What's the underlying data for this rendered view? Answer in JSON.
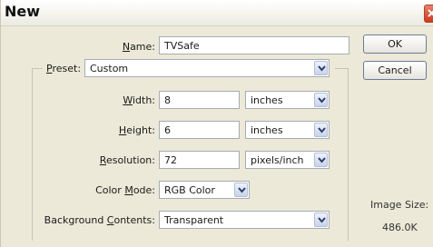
{
  "dialog": {
    "title": "New",
    "buttons": {
      "ok": "OK",
      "cancel": "Cancel"
    }
  },
  "form": {
    "name": {
      "label": "Name:",
      "value": "TVSafe"
    },
    "preset": {
      "label": "Preset:",
      "value": "Custom"
    },
    "width": {
      "label": "Width:",
      "value": "8",
      "unit": "inches"
    },
    "height": {
      "label": "Height:",
      "value": "6",
      "unit": "inches"
    },
    "resolution": {
      "label": "Resolution:",
      "value": "72",
      "unit": "pixels/inch"
    },
    "color_mode": {
      "label": "Color Mode:",
      "value": "RGB Color"
    },
    "background": {
      "label": "Background Contents:",
      "value": "Transparent"
    }
  },
  "image_size": {
    "label": "Image Size:",
    "value": "486.0K"
  },
  "icons": {
    "close": "close-icon",
    "dropdown": "chevron-down-icon"
  },
  "colors": {
    "dialog_bg": "#ece9d8",
    "close_button": "#d2462a"
  }
}
